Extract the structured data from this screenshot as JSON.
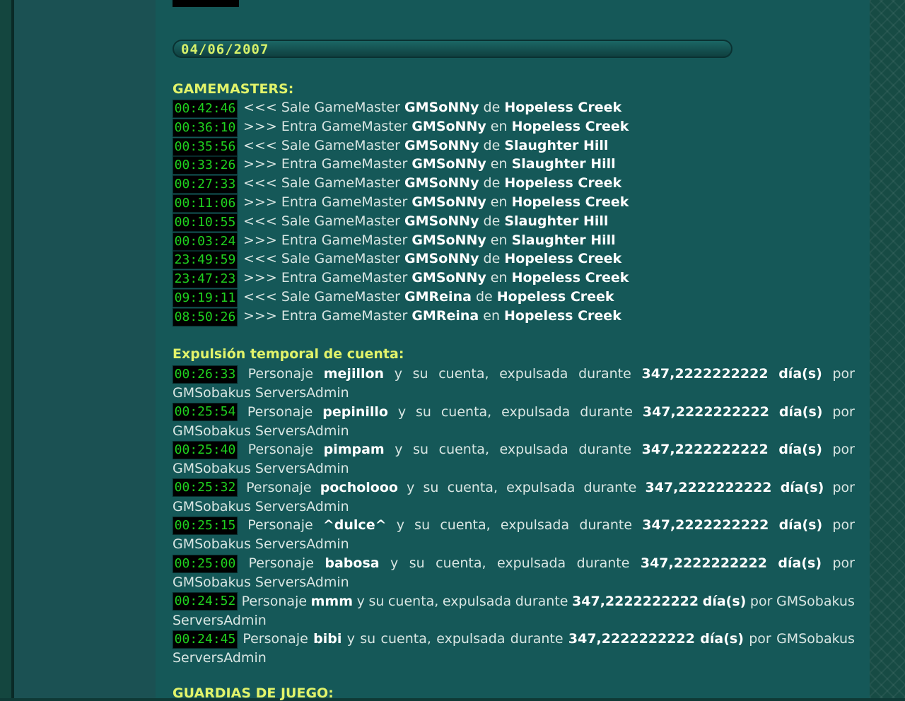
{
  "date": "04/06/2007",
  "gm_section": {
    "title": "GAMEMASTERS:",
    "entries": [
      {
        "time": "00:42:46",
        "arrow": "<<<",
        "action": "Sale GameMaster",
        "gm": "GMSoNNy",
        "prep": "de",
        "zone": "Hopeless Creek"
      },
      {
        "time": "00:36:10",
        "arrow": ">>>",
        "action": "Entra GameMaster",
        "gm": "GMSoNNy",
        "prep": "en",
        "zone": "Hopeless Creek"
      },
      {
        "time": "00:35:56",
        "arrow": "<<<",
        "action": "Sale GameMaster",
        "gm": "GMSoNNy",
        "prep": "de",
        "zone": "Slaughter Hill"
      },
      {
        "time": "00:33:26",
        "arrow": ">>>",
        "action": "Entra GameMaster",
        "gm": "GMSoNNy",
        "prep": "en",
        "zone": "Slaughter Hill"
      },
      {
        "time": "00:27:33",
        "arrow": "<<<",
        "action": "Sale GameMaster",
        "gm": "GMSoNNy",
        "prep": "de",
        "zone": "Hopeless Creek"
      },
      {
        "time": "00:11:06",
        "arrow": ">>>",
        "action": "Entra GameMaster",
        "gm": "GMSoNNy",
        "prep": "en",
        "zone": "Hopeless Creek"
      },
      {
        "time": "00:10:55",
        "arrow": "<<<",
        "action": "Sale GameMaster",
        "gm": "GMSoNNy",
        "prep": "de",
        "zone": "Slaughter Hill"
      },
      {
        "time": "00:03:24",
        "arrow": ">>>",
        "action": "Entra GameMaster",
        "gm": "GMSoNNy",
        "prep": "en",
        "zone": "Slaughter Hill"
      },
      {
        "time": "23:49:59",
        "arrow": "<<<",
        "action": "Sale GameMaster",
        "gm": "GMSoNNy",
        "prep": "de",
        "zone": "Hopeless Creek"
      },
      {
        "time": "23:47:23",
        "arrow": ">>>",
        "action": "Entra GameMaster",
        "gm": "GMSoNNy",
        "prep": "en",
        "zone": "Hopeless Creek"
      },
      {
        "time": "09:19:11",
        "arrow": "<<<",
        "action": "Sale GameMaster",
        "gm": "GMReina",
        "prep": "de",
        "zone": "Hopeless Creek"
      },
      {
        "time": "08:50:26",
        "arrow": ">>>",
        "action": "Entra GameMaster",
        "gm": "GMReina",
        "prep": "en",
        "zone": "Hopeless Creek"
      }
    ]
  },
  "expulsion_section": {
    "title": "Expulsión temporal de cuenta:",
    "words": {
      "personaje": "Personaje",
      "y": "y",
      "su": "su",
      "cuenta": "cuenta,",
      "expulsada": "expulsada",
      "durante": "durante",
      "dias": "día(s)",
      "por": "por"
    },
    "duration": "347,2222222222",
    "admin": "GMSobakus ServersAdmin",
    "admin_first": "GMSobakus",
    "admin_second": "ServersAdmin",
    "entries": [
      {
        "time": "00:26:33",
        "name": "mejillon"
      },
      {
        "time": "00:25:54",
        "name": "pepinillo"
      },
      {
        "time": "00:25:40",
        "name": "pimpam"
      },
      {
        "time": "00:25:32",
        "name": "pocholooo"
      },
      {
        "time": "00:25:15",
        "name": "^dulce^"
      },
      {
        "time": "00:25:00",
        "name": "babosa"
      },
      {
        "time": "00:24:52",
        "name": "mmm"
      },
      {
        "time": "00:24:45",
        "name": "bibi"
      }
    ]
  },
  "guardias_section": {
    "title": "GUARDIAS DE JUEGO:"
  }
}
